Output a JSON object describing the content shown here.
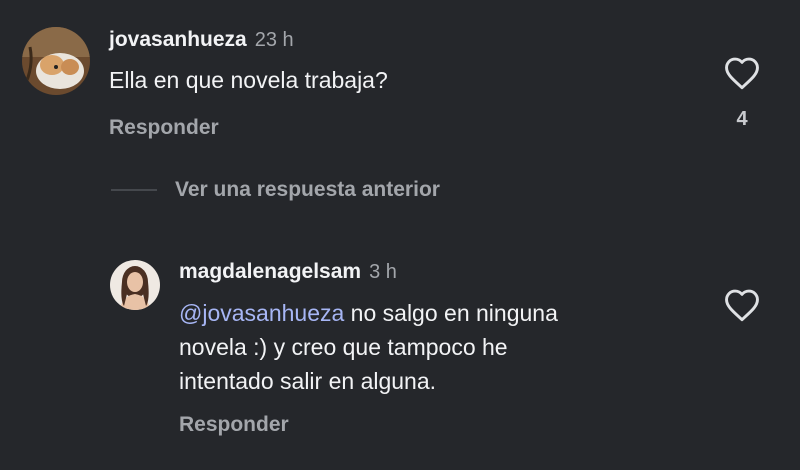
{
  "comment": {
    "username": "jovasanhueza",
    "time": "23 h",
    "text": "Ella en que novela trabaja?",
    "reply_label": "Responder",
    "like_count": "4",
    "avatar": "hamster-photo-avatar",
    "like_icon": "heart-outline-icon"
  },
  "thread": {
    "view_previous_label": "Ver una respuesta anterior"
  },
  "reply": {
    "username": "magdalenagelsam",
    "time": "3 h",
    "mention": "@jovasanhueza",
    "text_line1": " no salgo en ninguna",
    "text_line2": "novela :) y creo que tampoco he",
    "text_line3": "intentado salir en alguna.",
    "reply_label": "Responder",
    "avatar": "woman-portrait-avatar",
    "like_icon": "heart-outline-icon"
  },
  "colors": {
    "background": "#25272b",
    "text": "#f2f3f5",
    "secondary": "#a3a6ab",
    "mention": "#a7b6f5"
  }
}
